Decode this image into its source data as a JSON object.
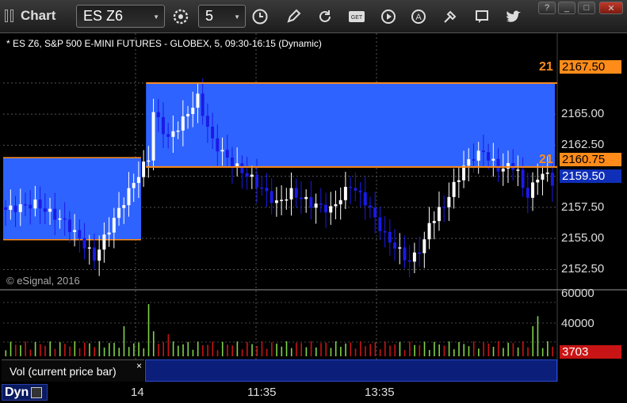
{
  "window": {
    "title": "Chart",
    "controls": [
      "?",
      "_",
      "□",
      "✕"
    ]
  },
  "toolbar": {
    "symbol": "ES Z6",
    "interval": "5",
    "icons": [
      "settings-icon",
      "clock-icon",
      "pencil-icon",
      "refresh-icon",
      "get-icon",
      "play-icon",
      "alert-icon",
      "tools-icon",
      "comment-icon",
      "twitter-icon"
    ]
  },
  "chart": {
    "header": "* ES Z6, S&P 500 E-MINI FUTURES - GLOBEX, 5, 09:30-16:15 (Dynamic)",
    "watermark": "© eSignal, 2016",
    "price_axis": [
      "2167.50",
      "2165.00",
      "2162.50",
      "2160.75",
      "2159.50",
      "2157.50",
      "2155.00",
      "2152.50"
    ],
    "current_price": "2159.50",
    "level_upper_label": "21",
    "level_upper_value": "2167.50",
    "level_lower_label": "21",
    "level_lower_value": "2160.75",
    "volume_axis": [
      "60000",
      "40000"
    ],
    "volume_current": "3703",
    "volume_panel_label": "Vol (current price bar)",
    "volume_close": "×",
    "time_labels": [
      "14",
      "11:35",
      "13:35"
    ],
    "dyn_label": "Dyn",
    "colors": {
      "zone": "#2E63FF",
      "level_line": "#FF8C1A",
      "up": "#FFFFFF",
      "down": "#1A1AE6",
      "vol_up": "#7FD34A",
      "vol_down": "#C81414",
      "current_price_bg": "#0F2FB8",
      "volume_tag_bg": "#C81414"
    }
  },
  "chart_data": {
    "type": "candlestick",
    "symbol": "ES Z6",
    "interval": "5",
    "y_ticks": [
      2167.5,
      2165.0,
      2162.5,
      2160.0,
      2157.5,
      2155.0,
      2152.5
    ],
    "ylim": [
      2151.0,
      2171.5
    ],
    "zones": [
      {
        "from_bar": 0,
        "to_bar": 27,
        "top": 2161.5,
        "bottom": 2154.9
      },
      {
        "from_bar": 29,
        "to_bar": 111,
        "top": 2167.5,
        "bottom": 2160.75
      }
    ],
    "levels": [
      2167.5,
      2160.75
    ],
    "current_price": 2159.5,
    "volume_ticks": [
      60000,
      40000
    ],
    "volume_current": 3703
  }
}
